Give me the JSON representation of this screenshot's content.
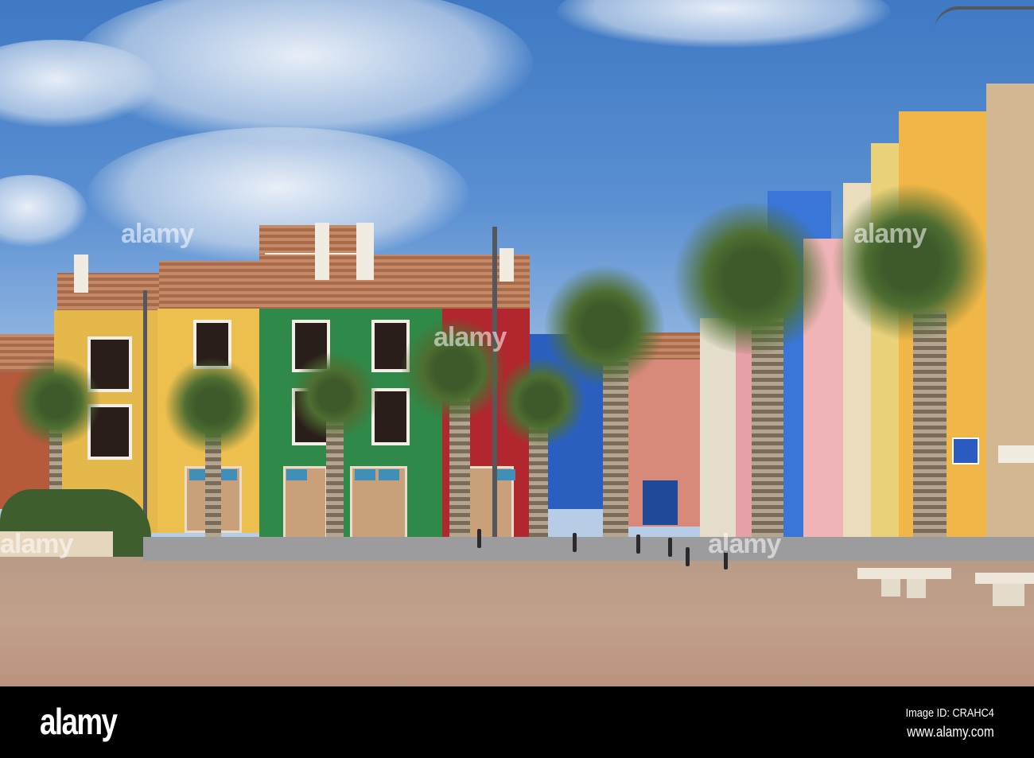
{
  "photo": {
    "subject": "Colorful houses and palm trees on a plaza",
    "watermark": "alamy",
    "colors": {
      "sky": "#4a82c8",
      "yellow": "#e6b84a",
      "green": "#2f8a4a",
      "red": "#b2262e",
      "blue": "#2a5fc0",
      "pink": "#d88a7a",
      "plaza": "#bf9c86"
    }
  },
  "footer": {
    "logo": "alamy",
    "image_id": "Image ID: CRAHC4",
    "url": "www.alamy.com"
  }
}
